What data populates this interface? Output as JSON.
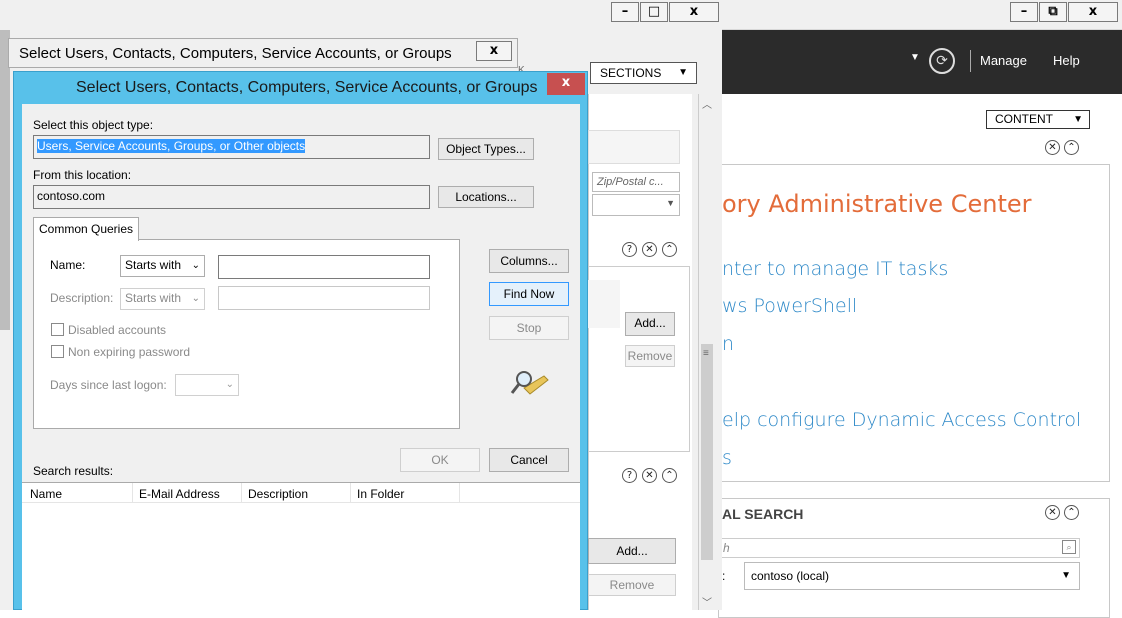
{
  "adac": {
    "header": {
      "manage": "Manage",
      "help": "Help",
      "refresh_icon": "refresh-icon"
    },
    "content_dropdown": "CONTENT",
    "title": "ory Administrative Center",
    "links": [
      "nter to manage IT tasks",
      "ws PowerShell",
      "n",
      "elp configure Dynamic Access Control",
      "s"
    ],
    "global_search_title": "AL SEARCH",
    "search_placeholder": "h",
    "scope_label": ":",
    "scope_value": "contoso (local)",
    "caption_buttons": [
      "–",
      "⧉",
      "x"
    ]
  },
  "mid": {
    "caption_buttons": [
      "–",
      "□",
      "x"
    ],
    "sections_dropdown": "SECTIONS",
    "zip_placeholder": "Zip/Postal c...",
    "add1": "Add...",
    "remove1": "Remove",
    "add2": "Add...",
    "remove2": "Remove",
    "partial_text": "K"
  },
  "dialog_back": {
    "title": "Select Users, Contacts, Computers, Service Accounts, or Groups",
    "close": "x"
  },
  "dialog": {
    "title": "Select Users, Contacts, Computers, Service Accounts, or Groups",
    "close": "x",
    "object_type_label": "Select this object type:",
    "object_type_value": "Users, Service Accounts, Groups, or Other objects",
    "object_types_button": "Object Types...",
    "location_label": "From this location:",
    "location_value": "contoso.com",
    "locations_button": "Locations...",
    "tab": "Common Queries",
    "name_label": "Name:",
    "name_match": "Starts with",
    "description_label": "Description:",
    "description_match": "Starts with",
    "disabled_accounts": "Disabled accounts",
    "non_expiring": "Non expiring password",
    "days_label": "Days since last logon:",
    "columns_button": "Columns...",
    "find_now_button": "Find Now",
    "stop_button": "Stop",
    "ok_button": "OK",
    "cancel_button": "Cancel",
    "search_results_label": "Search results:",
    "columns": [
      "Name",
      "E-Mail Address",
      "Description",
      "In Folder"
    ]
  }
}
